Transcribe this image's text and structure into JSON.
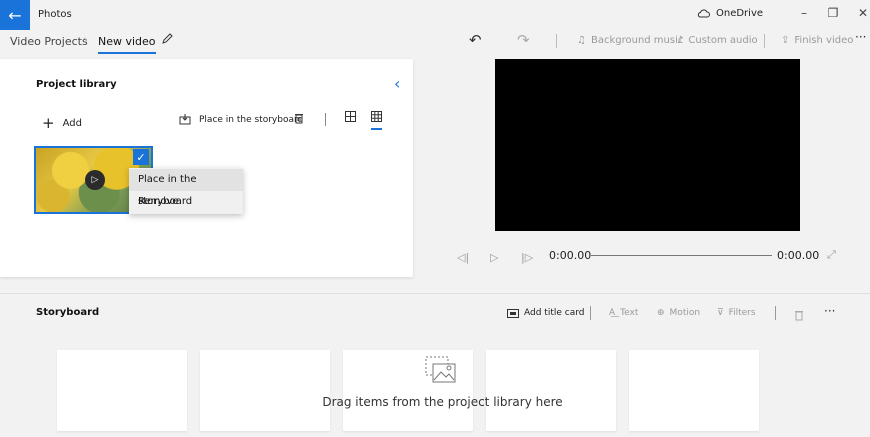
{
  "window": {
    "app_title": "Photos",
    "onedrive_label": "OneDrive",
    "back_icon": "←",
    "controls": {
      "minimize": "–",
      "restore": "❐",
      "close": "✕"
    }
  },
  "breadcrumb": {
    "parent": "Video Projects",
    "separator": "›",
    "current": "New video"
  },
  "toolbar": {
    "undo_icon": "↶",
    "redo_icon": "↷",
    "background_music": "Background music",
    "custom_audio": "Custom audio",
    "finish_video": "Finish video",
    "more": "···"
  },
  "library": {
    "title": "Project library",
    "add_label": "Add",
    "place_label": "Place in the storyboard",
    "collapse_icon": "‹",
    "context_menu": [
      "Place in the storyboard",
      "Remove"
    ]
  },
  "preview": {
    "time_start": "0:00.00",
    "time_end": "0:00.00"
  },
  "storyboard": {
    "title": "Storyboard",
    "add_title_card": "Add title card",
    "text": "Text",
    "motion": "Motion",
    "filters": "Filters",
    "more": "···",
    "empty_message": "Drag items from the project library here"
  },
  "colors": {
    "accent": "#1a73d9",
    "background": "#f2f2f2",
    "panel": "#ffffff",
    "preview": "#000000"
  }
}
